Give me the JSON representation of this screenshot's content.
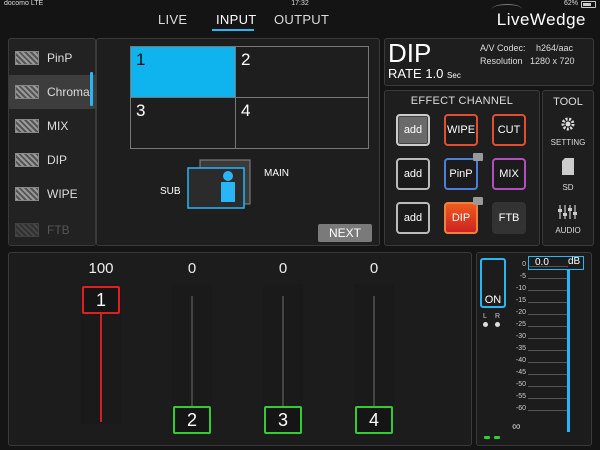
{
  "status_bar": {
    "carrier": "docomo  LTE",
    "time": "17:32",
    "battery": "62%"
  },
  "nav": {
    "tabs": [
      "LIVE",
      "INPUT",
      "OUTPUT"
    ],
    "active": "INPUT"
  },
  "brand": "LiveWedge",
  "source_list": [
    {
      "label": "PinP",
      "state": "normal"
    },
    {
      "label": "Chroma",
      "state": "selected"
    },
    {
      "label": "MIX",
      "state": "normal"
    },
    {
      "label": "DIP",
      "state": "normal"
    },
    {
      "label": "WIPE",
      "state": "normal"
    },
    {
      "label": "FTB",
      "state": "dim"
    }
  ],
  "preview": {
    "cells": [
      "1",
      "2",
      "3",
      "4"
    ],
    "active_cell": "1",
    "main_label": "MAIN",
    "sub_label": "SUB",
    "next_label": "NEXT"
  },
  "info": {
    "effect": "DIP",
    "rate_label": "RATE",
    "rate_value": "1.0",
    "rate_unit": "Sec",
    "codec_label": "A/V Codec:",
    "codec_value": "h264/aac",
    "resolution_label": "Resolution",
    "resolution_value": "1280 x 720"
  },
  "effect_channel": {
    "title": "EFFECT CHANNEL",
    "rows": [
      [
        "add",
        "WIPE",
        "CUT"
      ],
      [
        "add",
        "PinP",
        "MIX"
      ],
      [
        "add",
        "DIP",
        "FTB"
      ]
    ]
  },
  "tool": {
    "title": "TOOL",
    "items": [
      {
        "label": "SETTING",
        "icon": "gear-icon"
      },
      {
        "label": "SD",
        "icon": "sd-card-icon"
      },
      {
        "label": "AUDIO",
        "icon": "mixer-icon"
      }
    ]
  },
  "faders": [
    {
      "value": "100",
      "label": "1"
    },
    {
      "value": "0",
      "label": "2"
    },
    {
      "value": "0",
      "label": "3"
    },
    {
      "value": "0",
      "label": "4"
    }
  ],
  "audio": {
    "on_label": "ON",
    "left": "L",
    "right": "R",
    "db_value": "0.0",
    "db_unit": "dB",
    "scale": [
      "0",
      "-5",
      "-10",
      "-15",
      "-20",
      "-25",
      "-30",
      "-35",
      "-40",
      "-45",
      "-50",
      "-55",
      "-60"
    ],
    "infinity": "∞"
  },
  "colors": {
    "accent": "#29b6f6",
    "active_fader": "#e02020",
    "idle_fader": "#33cc33",
    "dip_active": "#f05a1e"
  }
}
